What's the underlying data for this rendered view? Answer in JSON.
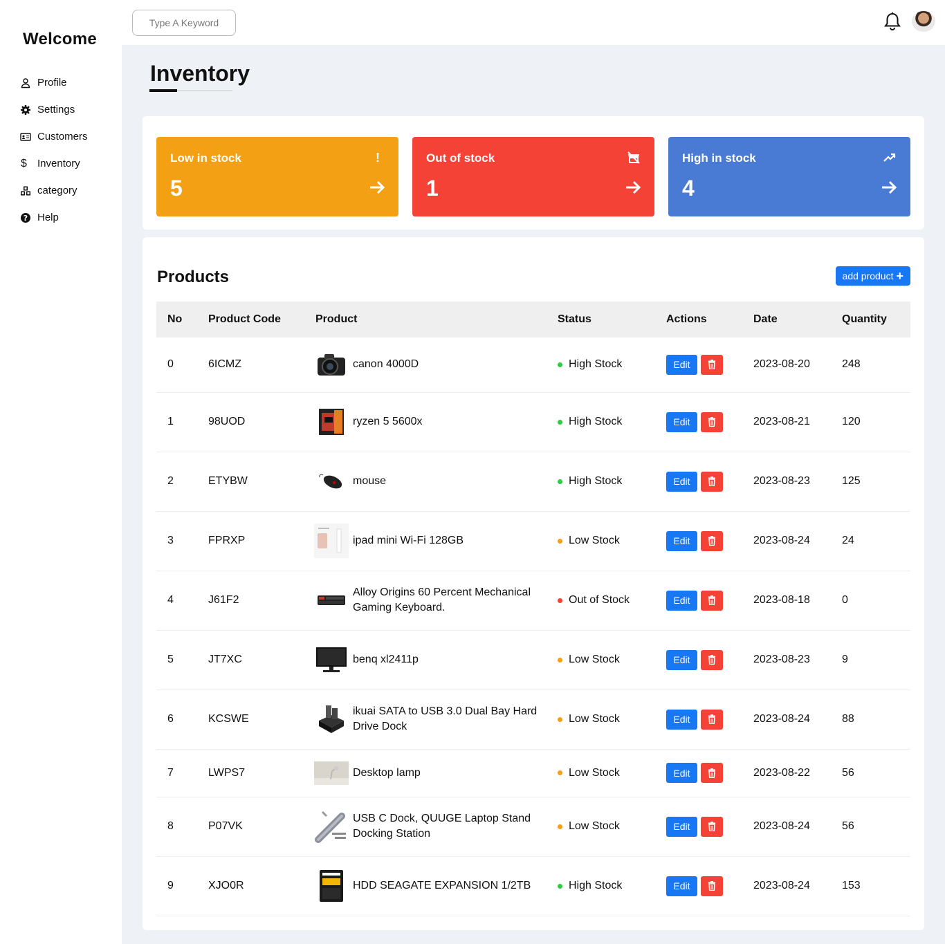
{
  "sidebar": {
    "brand": "Welcome",
    "items": [
      {
        "label": "Profile",
        "icon": "user-icon"
      },
      {
        "label": "Settings",
        "icon": "gear-icon"
      },
      {
        "label": "Customers",
        "icon": "id-card-icon"
      },
      {
        "label": "Inventory",
        "icon": "dollar-icon"
      },
      {
        "label": "category",
        "icon": "cubes-icon"
      },
      {
        "label": "Help",
        "icon": "question-circle-icon"
      }
    ]
  },
  "topbar": {
    "search_placeholder": "Type A Keyword",
    "notification_icon": "bell-icon",
    "avatar_icon": "user-avatar"
  },
  "page": {
    "title": "Inventory"
  },
  "stats": {
    "low": {
      "title": "Low in stock",
      "value": "5",
      "icon": "exclamation-icon",
      "color": "#f4a014"
    },
    "out": {
      "title": "Out of stock",
      "value": "1",
      "icon": "store-slash-icon",
      "color": "#f44336"
    },
    "high": {
      "title": "High in stock",
      "value": "4",
      "icon": "trend-up-icon",
      "color": "#4a7bd4"
    }
  },
  "products": {
    "title": "Products",
    "add_label": "add product",
    "columns": [
      "No",
      "Product Code",
      "Product",
      "Status",
      "Actions",
      "Date",
      "Quantity"
    ],
    "edit_label": "Edit",
    "status_colors": {
      "High Stock": "#2ecc40",
      "Low Stock": "#f4a014",
      "Out of Stock": "#f44336"
    },
    "rows": [
      {
        "no": "0",
        "code": "6ICMZ",
        "name": "canon 4000D",
        "thumb": "camera",
        "status": "High Stock",
        "date": "2023-08-20",
        "qty": "248"
      },
      {
        "no": "1",
        "code": "98UOD",
        "name": "ryzen 5 5600x",
        "thumb": "cpu",
        "status": "High Stock",
        "date": "2023-08-21",
        "qty": "120"
      },
      {
        "no": "2",
        "code": "ETYBW",
        "name": "mouse",
        "thumb": "mouse",
        "status": "High Stock",
        "date": "2023-08-23",
        "qty": "125"
      },
      {
        "no": "3",
        "code": "FPRXP",
        "name": "ipad mini Wi-Fi 128GB",
        "thumb": "tablet",
        "status": "Low Stock",
        "date": "2023-08-24",
        "qty": "24"
      },
      {
        "no": "4",
        "code": "J61F2",
        "name": "Alloy Origins 60 Percent Mechanical Gaming Keyboard.",
        "thumb": "keyboard",
        "status": "Out of Stock",
        "date": "2023-08-18",
        "qty": "0"
      },
      {
        "no": "5",
        "code": "JT7XC",
        "name": "benq xl2411p",
        "thumb": "monitor",
        "status": "Low Stock",
        "date": "2023-08-23",
        "qty": "9"
      },
      {
        "no": "6",
        "code": "KCSWE",
        "name": "ikuai SATA to USB 3.0 Dual Bay Hard Drive Dock",
        "thumb": "dock",
        "status": "Low Stock",
        "date": "2023-08-24",
        "qty": "88"
      },
      {
        "no": "7",
        "code": "LWPS7",
        "name": "Desktop lamp",
        "thumb": "lamp",
        "status": "Low Stock",
        "date": "2023-08-22",
        "qty": "56"
      },
      {
        "no": "8",
        "code": "P07VK",
        "name": "USB C Dock, QUUGE Laptop Stand Docking Station",
        "thumb": "usbhub",
        "status": "Low Stock",
        "date": "2023-08-24",
        "qty": "56"
      },
      {
        "no": "9",
        "code": "XJO0R",
        "name": "HDD SEAGATE EXPANSION 1/2TB",
        "thumb": "hdd",
        "status": "High Stock",
        "date": "2023-08-24",
        "qty": "153"
      }
    ]
  }
}
